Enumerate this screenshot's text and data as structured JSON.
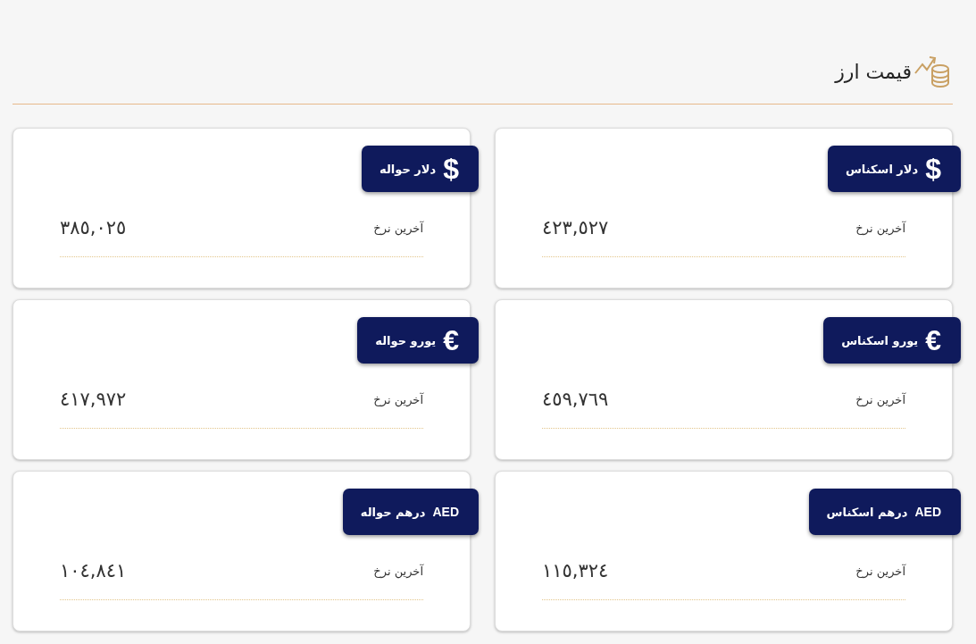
{
  "header": {
    "title": "قیمت ارز"
  },
  "cards": [
    {
      "symbol": "$",
      "name": "دلار اسکناس",
      "label": "آخرین نرخ",
      "value": "٤٢٣,٥٢٧"
    },
    {
      "symbol": "$",
      "name": "دلار حواله",
      "label": "آخرین نرخ",
      "value": "٣٨٥,٠٢٥"
    },
    {
      "symbol": "€",
      "name": "یورو اسکناس",
      "label": "آخرین نرخ",
      "value": "٤٥٩,٧٦٩"
    },
    {
      "symbol": "€",
      "name": "یورو حواله",
      "label": "آخرین نرخ",
      "value": "٤١٧,٩٧٢"
    },
    {
      "symbol": "AED",
      "name": "درهم اسکناس",
      "label": "آخرین نرخ",
      "value": "١١٥,٣٢٤"
    },
    {
      "symbol": "AED",
      "name": "درهم حواله",
      "label": "آخرین نرخ",
      "value": "١٠٤,٨٤١"
    }
  ]
}
